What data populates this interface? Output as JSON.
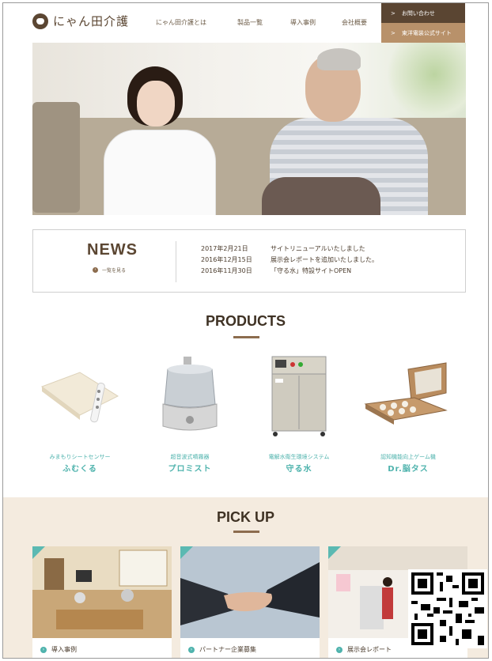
{
  "header": {
    "logo_text": "にゃん田介護",
    "nav": [
      "にゃん田介護とは",
      "製品一覧",
      "導入事例",
      "会社概要"
    ],
    "contact_label": "お問い合わせ",
    "official_site_label": "東洋電装公式サイト"
  },
  "news": {
    "title": "NEWS",
    "more_label": "一覧を見る",
    "items": [
      {
        "date": "2017年2月21日",
        "text": "サイトリニューアルいたしました"
      },
      {
        "date": "2016年12月15日",
        "text": "展示会レポートを追加いたしました。"
      },
      {
        "date": "2016年11月30日",
        "text": "「守る水」特設サイトOPEN"
      }
    ]
  },
  "products": {
    "title": "PRODUCTS",
    "items": [
      {
        "sub": "みまもりシートセンサー",
        "name": "ふむくる",
        "icon": "sheet-sensor"
      },
      {
        "sub": "超音波式噴霧器",
        "name": "プロミスト",
        "icon": "humidifier"
      },
      {
        "sub": "電解水衛生環境システム",
        "name": "守る水",
        "icon": "water-system"
      },
      {
        "sub": "認知機能向上ゲーム機",
        "name": "Dr.脳タス",
        "icon": "game-machine"
      }
    ]
  },
  "pickup": {
    "title": "PICK UP",
    "items": [
      {
        "label": "導入事例",
        "icon": "facility-photo"
      },
      {
        "label": "パートナー企業募集",
        "icon": "handshake-photo"
      },
      {
        "label": "展示会レポート",
        "icon": "exhibition-photo"
      }
    ]
  },
  "colors": {
    "brown": "#5a4532",
    "tan": "#b8916a",
    "teal": "#4fb3ad",
    "beige": "#f4ebdf"
  }
}
